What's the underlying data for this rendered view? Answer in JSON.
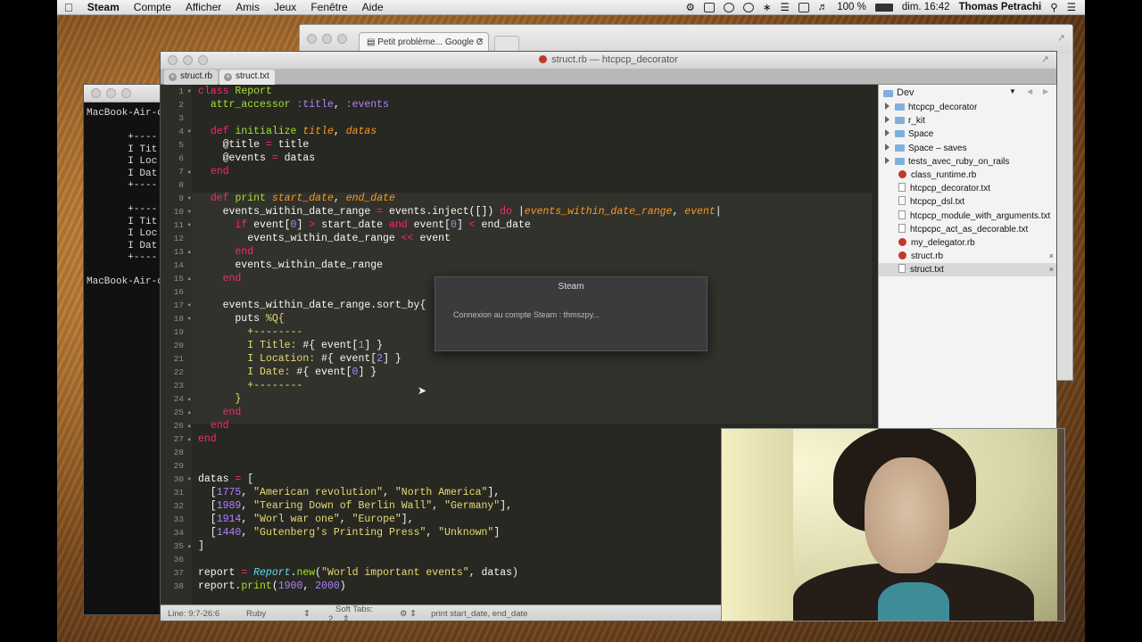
{
  "menubar": {
    "apple": "",
    "app": "Steam",
    "items": [
      "Compte",
      "Afficher",
      "Amis",
      "Jeux",
      "Fenêtre",
      "Aide"
    ],
    "battery": "100 %",
    "clock": "dim. 16:42",
    "user": "Thomas Petrachi"
  },
  "terminal": {
    "lines": "MacBook-Air-d\n\n       +----\n       I Tit\n       I Loc\n       I Dat\n       +----\n\n       +----\n       I Tit\n       I Loc\n       I Dat\n       +----\n\nMacBook-Air-d"
  },
  "chrome": {
    "tab_title": "Petit problème... Google C"
  },
  "sublime": {
    "window_title": "struct.rb — htcpcp_decorator",
    "tabs": [
      "struct.rb",
      "struct.txt"
    ],
    "status": {
      "position": "Line: 9:7-26:6",
      "syntax": "Ruby",
      "tabs": "Soft Tabs: 2",
      "symbol": "print start_date, end_date"
    }
  },
  "sidebar": {
    "header": "Dev",
    "items": [
      {
        "label": "htcpcp_decorator",
        "type": "folder"
      },
      {
        "label": "r_kit",
        "type": "folder"
      },
      {
        "label": "Space",
        "type": "folder"
      },
      {
        "label": "Space – saves",
        "type": "folder"
      },
      {
        "label": "tests_avec_ruby_on_rails",
        "type": "folder"
      },
      {
        "label": "class_runtime.rb",
        "type": "rb"
      },
      {
        "label": "htcpcp_decorator.txt",
        "type": "txt"
      },
      {
        "label": "htcpcp_dsl.txt",
        "type": "txt"
      },
      {
        "label": "htcpcp_module_with_arguments.txt",
        "type": "txt"
      },
      {
        "label": "htcpcpc_act_as_decorable.txt",
        "type": "txt"
      },
      {
        "label": "my_delegator.rb",
        "type": "rb"
      },
      {
        "label": "struct.rb",
        "type": "rb",
        "open": true
      },
      {
        "label": "struct.txt",
        "type": "txt",
        "open": true,
        "selected": true
      }
    ]
  },
  "steam_dialog": {
    "title": "Steam",
    "message": "Connexion au compte Steam : thmszpy..."
  },
  "code": {
    "line_numbers": [
      "1",
      "2",
      "3",
      "4",
      "5",
      "6",
      "7",
      "8",
      "9",
      "10",
      "11",
      "12",
      "13",
      "14",
      "15",
      "16",
      "17",
      "18",
      "19",
      "20",
      "21",
      "22",
      "23",
      "24",
      "25",
      "26",
      "27",
      "28",
      "29",
      "30",
      "31",
      "32",
      "33",
      "34",
      "35",
      "36",
      "37",
      "38"
    ],
    "fold_open": [
      1,
      4,
      9,
      10,
      11,
      17,
      18,
      30
    ],
    "fold_end": [
      7,
      13,
      15,
      24,
      25,
      26,
      27,
      35
    ]
  },
  "colors": {
    "editor_bg": "#272822",
    "keyword": "#f92672",
    "string": "#e6db74",
    "number": "#ae81ff",
    "function": "#a6e22e",
    "constant": "#66d9ef"
  }
}
